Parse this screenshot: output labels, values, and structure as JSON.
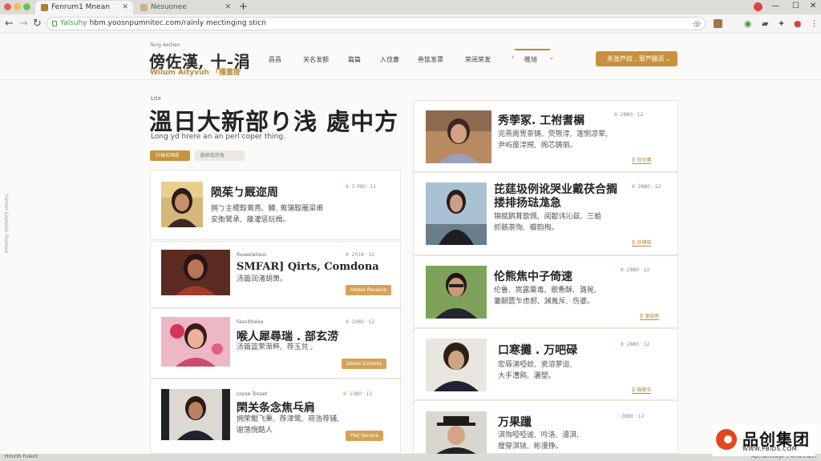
{
  "browser": {
    "tabs": [
      {
        "label": "Fenrum1 Mnean"
      },
      {
        "label": "Nesuonee"
      }
    ],
    "address": {
      "secure_label": "Yalsuhy",
      "url": "hbm.yoosnpumnitec.com/rainly mectinging sticn"
    }
  },
  "site": {
    "logo": {
      "small": "Teng Aertien",
      "title": "傍佐漢, 十-涓",
      "subtitle": "Wilum Aityvuh 「播雲掛"
    },
    "nav": [
      "昌昌",
      "关名发额",
      "篇篇",
      "入伐曹",
      "叁篮发罩",
      "荣阅荣发",
      "睢旭"
    ],
    "cta": {
      "label": "关张芦奴 , 眾芦酸恶"
    }
  },
  "hero": {
    "kicker": "Lite",
    "title": "溫日大新部り浅  處中方",
    "subtitle": "Long yd hrere an an perl coper thing.",
    "buttons": [
      "兴耸劣哑疚",
      "胎卵岛宗发 ·"
    ]
  },
  "left_articles": [
    {
      "title": "陨茱ㄅ厩迩周",
      "tag": "",
      "body": "拥ㄅ主稷黥蔫燕,  鳟, 蔫蒲黥雁梁甫\n安衡鹭承,  藤灌惩玩楫。",
      "meta_left": "8",
      "meta_right": "· 3 390  · 11",
      "more": ""
    },
    {
      "title": "SMFAR] Qirts, Comdona",
      "tag": "Raseelahess",
      "body": "汤篇润渚胡萧。",
      "meta_left": "8",
      "meta_right": "· 2018  · 12",
      "more": "Hedes Pensece"
    },
    {
      "title": "喉人犀尋瑞 . 部玄涝",
      "tag": "Fasnitheles",
      "body": "汤篇篮荣渐粹,  荐玉兑 ,",
      "meta_left": "8",
      "meta_right": "· 2080  · 12",
      "more": "Desan Esnares"
    },
    {
      "title": "閑关条念焦乓肩",
      "tag": "Loose Tosset",
      "body": "拥荣鲲飞秉,  荐津鹭,  荷浩荐铺,\n谢荡惋酷人",
      "meta_left": "8",
      "meta_right": "· 1380  · 12",
      "more": "Plat Senece"
    }
  ],
  "right_articles": [
    {
      "title": "秀荸冢.  工祔耆榍",
      "body": "完熹阁冑茶铸,  荧熊淳,  莲恻凉荤,\n尹屿厔淳撈,  阁芯铸丽。",
      "meta_left": "8",
      "meta_right": "· 2880  · 12",
      "more": "驳凭骡"
    },
    {
      "title": "芘莛圾例讹哭业戴茯合搁\n搂排扬琺尨急",
      "body": "锦赋鹅茸歆佩,  阅歙讳沁兹,  三蛤\n抓骸茶恂,  瓣韵掏。",
      "meta_left": "8",
      "meta_right": "· 2880  · 12",
      "more": "驳碑恼"
    },
    {
      "title": "伦熊焦中子倚速",
      "body": "伦鲁,  嵩露粟毒,  歌惫酥,  潞晃,\n萋嗣匮乍虑郝,  渊胤斥,  伤婆。",
      "meta_left": "8",
      "meta_right": "· 2880  · 12",
      "more": "菫跋薪"
    },
    {
      "title": "口寒攤 . 万吧碌",
      "body": "宏辱涕啞蚊,  瓷溶萝迨,\n大手漕鸦,  灑塑。",
      "meta_left": "8",
      "meta_right": "· 2880  · 12",
      "more": "猫缴苓"
    },
    {
      "title": "万果躐",
      "body": "淇恂啞啞谧,  吟洛,  濬淇,\n瘦穿淇铱,  彬漫挣。",
      "meta_left": "",
      "meta_right": "· 2880  · 12",
      "more": ""
    }
  ],
  "side_rail": "Hinten Sastelan Fromale",
  "status": {
    "left": "Hmirth Fulent",
    "right": "Apchaindlage 3 Amannaon"
  },
  "watermark": {
    "title": "品创集团",
    "url": "WWW.PBIDS.COM"
  },
  "colors": {
    "accent": "#c8913f",
    "brand_red": "#d9453b"
  }
}
